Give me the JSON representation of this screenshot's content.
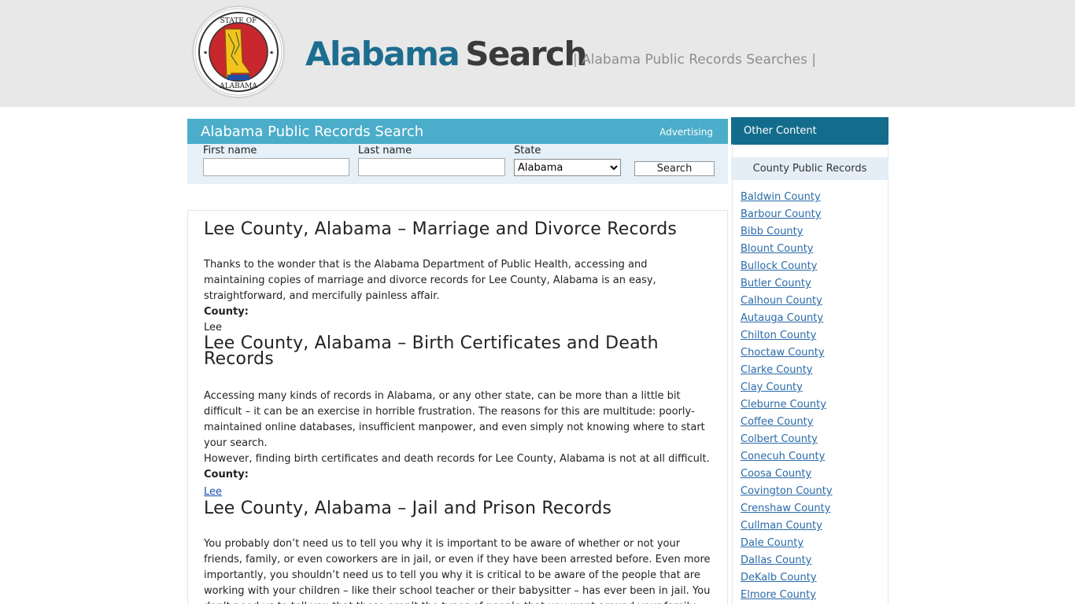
{
  "header": {
    "seal_text_top": "STATE OF",
    "seal_text_bottom": "ALABAMA",
    "logo_part1": "Alabama",
    "logo_part2": "Search",
    "tagline": "| Alabama Public Records Searches |"
  },
  "search": {
    "title": "Alabama Public Records Search",
    "advertising_label": "Advertising",
    "first_name_label": "First name",
    "first_name_value": "",
    "last_name_label": "Last name",
    "last_name_value": "",
    "state_label": "State",
    "state_selected": "Alabama",
    "search_button": "Search"
  },
  "sections": [
    {
      "heading": "Lee County, Alabama – Marriage and Divorce Records",
      "paragraphs": [
        "Thanks to the wonder that is the Alabama Department of Public Health, accessing and maintaining copies of marriage and divorce records for Lee County, Alabama is an easy, straightforward, and mercifully painless affair."
      ],
      "county_label": "County:",
      "county_value": "Lee"
    },
    {
      "heading": "Lee County, Alabama – Birth Certificates and Death Records",
      "paragraphs": [
        "Accessing many kinds of records in Alabama, or any other state, can be more than a little bit difficult – it can be an exercise in horrible frustration. The reasons for this are multitude: poorly-maintained online databases, insufficient manpower, and even simply not knowing where to start your search.",
        "However, finding birth certificates and death records for Lee County, Alabama is not at all difficult."
      ],
      "county_label": "County:",
      "county_value": "Lee"
    },
    {
      "heading": "Lee County, Alabama – Jail and Prison Records",
      "paragraphs": [
        "You probably don’t need us to tell you why it is important to be aware of whether or not your friends, family, or even coworkers are in jail, or even if they have been arrested before. Even more importantly, you shouldn’t need us to tell you why it is critical to be aware of the people that are working with your children – like their school teacher or their babysitter – has ever been in jail. You don’t need us to tell you that these aren’t the types of people that you want around your family."
      ]
    }
  ],
  "sidebar": {
    "title": "Other Content",
    "county_header": "County Public Records",
    "counties": [
      "Baldwin County",
      "Barbour County",
      "Bibb County",
      "Blount County",
      "Bullock County",
      "Butler County",
      "Calhoun County",
      "Autauga County",
      "Chilton County",
      "Choctaw County",
      "Clarke County",
      "Clay County",
      "Cleburne County",
      "Coffee County",
      "Colbert County",
      "Conecuh County",
      "Coosa County",
      "Covington County",
      "Crenshaw County",
      "Cullman County",
      "Dale County",
      "Dallas County",
      "DeKalb County",
      "Elmore County"
    ]
  },
  "colors": {
    "header_bg": "#e8e8e8",
    "logo_blue": "#1d6d8f",
    "search_bar": "#4badc9",
    "sidebar_title_bg": "#136c8c",
    "link": "#2a6aa8"
  }
}
